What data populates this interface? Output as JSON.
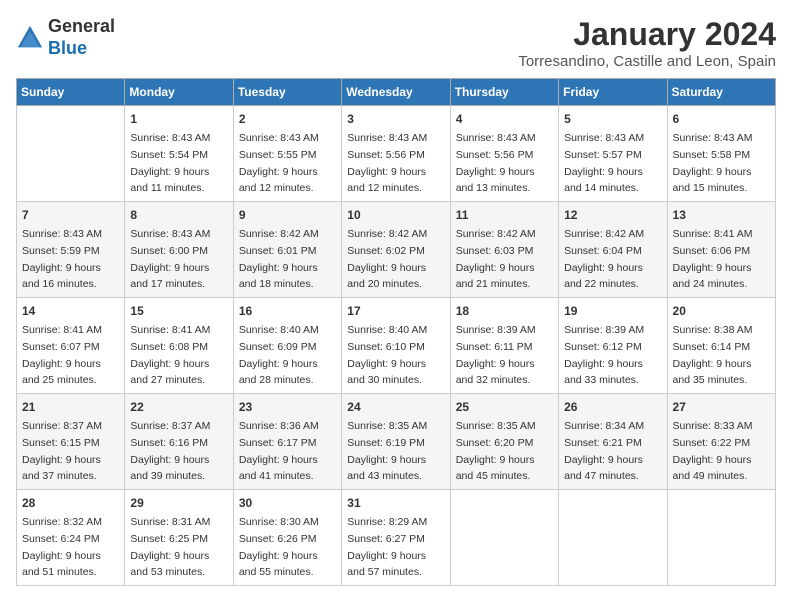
{
  "header": {
    "logo_line1": "General",
    "logo_line2": "Blue",
    "month_title": "January 2024",
    "location": "Torresandino, Castille and Leon, Spain"
  },
  "days_of_week": [
    "Sunday",
    "Monday",
    "Tuesday",
    "Wednesday",
    "Thursday",
    "Friday",
    "Saturday"
  ],
  "weeks": [
    [
      {
        "day": "",
        "info": ""
      },
      {
        "day": "1",
        "info": "Sunrise: 8:43 AM\nSunset: 5:54 PM\nDaylight: 9 hours\nand 11 minutes."
      },
      {
        "day": "2",
        "info": "Sunrise: 8:43 AM\nSunset: 5:55 PM\nDaylight: 9 hours\nand 12 minutes."
      },
      {
        "day": "3",
        "info": "Sunrise: 8:43 AM\nSunset: 5:56 PM\nDaylight: 9 hours\nand 12 minutes."
      },
      {
        "day": "4",
        "info": "Sunrise: 8:43 AM\nSunset: 5:56 PM\nDaylight: 9 hours\nand 13 minutes."
      },
      {
        "day": "5",
        "info": "Sunrise: 8:43 AM\nSunset: 5:57 PM\nDaylight: 9 hours\nand 14 minutes."
      },
      {
        "day": "6",
        "info": "Sunrise: 8:43 AM\nSunset: 5:58 PM\nDaylight: 9 hours\nand 15 minutes."
      }
    ],
    [
      {
        "day": "7",
        "info": "Sunrise: 8:43 AM\nSunset: 5:59 PM\nDaylight: 9 hours\nand 16 minutes."
      },
      {
        "day": "8",
        "info": "Sunrise: 8:43 AM\nSunset: 6:00 PM\nDaylight: 9 hours\nand 17 minutes."
      },
      {
        "day": "9",
        "info": "Sunrise: 8:42 AM\nSunset: 6:01 PM\nDaylight: 9 hours\nand 18 minutes."
      },
      {
        "day": "10",
        "info": "Sunrise: 8:42 AM\nSunset: 6:02 PM\nDaylight: 9 hours\nand 20 minutes."
      },
      {
        "day": "11",
        "info": "Sunrise: 8:42 AM\nSunset: 6:03 PM\nDaylight: 9 hours\nand 21 minutes."
      },
      {
        "day": "12",
        "info": "Sunrise: 8:42 AM\nSunset: 6:04 PM\nDaylight: 9 hours\nand 22 minutes."
      },
      {
        "day": "13",
        "info": "Sunrise: 8:41 AM\nSunset: 6:06 PM\nDaylight: 9 hours\nand 24 minutes."
      }
    ],
    [
      {
        "day": "14",
        "info": "Sunrise: 8:41 AM\nSunset: 6:07 PM\nDaylight: 9 hours\nand 25 minutes."
      },
      {
        "day": "15",
        "info": "Sunrise: 8:41 AM\nSunset: 6:08 PM\nDaylight: 9 hours\nand 27 minutes."
      },
      {
        "day": "16",
        "info": "Sunrise: 8:40 AM\nSunset: 6:09 PM\nDaylight: 9 hours\nand 28 minutes."
      },
      {
        "day": "17",
        "info": "Sunrise: 8:40 AM\nSunset: 6:10 PM\nDaylight: 9 hours\nand 30 minutes."
      },
      {
        "day": "18",
        "info": "Sunrise: 8:39 AM\nSunset: 6:11 PM\nDaylight: 9 hours\nand 32 minutes."
      },
      {
        "day": "19",
        "info": "Sunrise: 8:39 AM\nSunset: 6:12 PM\nDaylight: 9 hours\nand 33 minutes."
      },
      {
        "day": "20",
        "info": "Sunrise: 8:38 AM\nSunset: 6:14 PM\nDaylight: 9 hours\nand 35 minutes."
      }
    ],
    [
      {
        "day": "21",
        "info": "Sunrise: 8:37 AM\nSunset: 6:15 PM\nDaylight: 9 hours\nand 37 minutes."
      },
      {
        "day": "22",
        "info": "Sunrise: 8:37 AM\nSunset: 6:16 PM\nDaylight: 9 hours\nand 39 minutes."
      },
      {
        "day": "23",
        "info": "Sunrise: 8:36 AM\nSunset: 6:17 PM\nDaylight: 9 hours\nand 41 minutes."
      },
      {
        "day": "24",
        "info": "Sunrise: 8:35 AM\nSunset: 6:19 PM\nDaylight: 9 hours\nand 43 minutes."
      },
      {
        "day": "25",
        "info": "Sunrise: 8:35 AM\nSunset: 6:20 PM\nDaylight: 9 hours\nand 45 minutes."
      },
      {
        "day": "26",
        "info": "Sunrise: 8:34 AM\nSunset: 6:21 PM\nDaylight: 9 hours\nand 47 minutes."
      },
      {
        "day": "27",
        "info": "Sunrise: 8:33 AM\nSunset: 6:22 PM\nDaylight: 9 hours\nand 49 minutes."
      }
    ],
    [
      {
        "day": "28",
        "info": "Sunrise: 8:32 AM\nSunset: 6:24 PM\nDaylight: 9 hours\nand 51 minutes."
      },
      {
        "day": "29",
        "info": "Sunrise: 8:31 AM\nSunset: 6:25 PM\nDaylight: 9 hours\nand 53 minutes."
      },
      {
        "day": "30",
        "info": "Sunrise: 8:30 AM\nSunset: 6:26 PM\nDaylight: 9 hours\nand 55 minutes."
      },
      {
        "day": "31",
        "info": "Sunrise: 8:29 AM\nSunset: 6:27 PM\nDaylight: 9 hours\nand 57 minutes."
      },
      {
        "day": "",
        "info": ""
      },
      {
        "day": "",
        "info": ""
      },
      {
        "day": "",
        "info": ""
      }
    ]
  ]
}
